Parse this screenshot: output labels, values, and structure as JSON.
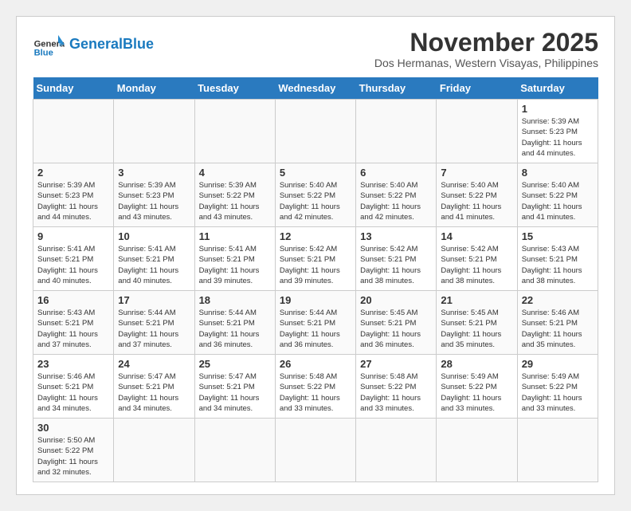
{
  "header": {
    "logo_general": "General",
    "logo_blue": "Blue",
    "month_title": "November 2025",
    "subtitle": "Dos Hermanas, Western Visayas, Philippines"
  },
  "weekdays": [
    "Sunday",
    "Monday",
    "Tuesday",
    "Wednesday",
    "Thursday",
    "Friday",
    "Saturday"
  ],
  "weeks": [
    [
      {
        "day": "",
        "sunrise": "",
        "sunset": "",
        "daylight": ""
      },
      {
        "day": "",
        "sunrise": "",
        "sunset": "",
        "daylight": ""
      },
      {
        "day": "",
        "sunrise": "",
        "sunset": "",
        "daylight": ""
      },
      {
        "day": "",
        "sunrise": "",
        "sunset": "",
        "daylight": ""
      },
      {
        "day": "",
        "sunrise": "",
        "sunset": "",
        "daylight": ""
      },
      {
        "day": "",
        "sunrise": "",
        "sunset": "",
        "daylight": ""
      },
      {
        "day": "1",
        "sunrise": "Sunrise: 5:39 AM",
        "sunset": "Sunset: 5:23 PM",
        "daylight": "Daylight: 11 hours and 44 minutes."
      }
    ],
    [
      {
        "day": "2",
        "sunrise": "Sunrise: 5:39 AM",
        "sunset": "Sunset: 5:23 PM",
        "daylight": "Daylight: 11 hours and 44 minutes."
      },
      {
        "day": "3",
        "sunrise": "Sunrise: 5:39 AM",
        "sunset": "Sunset: 5:23 PM",
        "daylight": "Daylight: 11 hours and 43 minutes."
      },
      {
        "day": "4",
        "sunrise": "Sunrise: 5:39 AM",
        "sunset": "Sunset: 5:22 PM",
        "daylight": "Daylight: 11 hours and 43 minutes."
      },
      {
        "day": "5",
        "sunrise": "Sunrise: 5:40 AM",
        "sunset": "Sunset: 5:22 PM",
        "daylight": "Daylight: 11 hours and 42 minutes."
      },
      {
        "day": "6",
        "sunrise": "Sunrise: 5:40 AM",
        "sunset": "Sunset: 5:22 PM",
        "daylight": "Daylight: 11 hours and 42 minutes."
      },
      {
        "day": "7",
        "sunrise": "Sunrise: 5:40 AM",
        "sunset": "Sunset: 5:22 PM",
        "daylight": "Daylight: 11 hours and 41 minutes."
      },
      {
        "day": "8",
        "sunrise": "Sunrise: 5:40 AM",
        "sunset": "Sunset: 5:22 PM",
        "daylight": "Daylight: 11 hours and 41 minutes."
      }
    ],
    [
      {
        "day": "9",
        "sunrise": "Sunrise: 5:41 AM",
        "sunset": "Sunset: 5:21 PM",
        "daylight": "Daylight: 11 hours and 40 minutes."
      },
      {
        "day": "10",
        "sunrise": "Sunrise: 5:41 AM",
        "sunset": "Sunset: 5:21 PM",
        "daylight": "Daylight: 11 hours and 40 minutes."
      },
      {
        "day": "11",
        "sunrise": "Sunrise: 5:41 AM",
        "sunset": "Sunset: 5:21 PM",
        "daylight": "Daylight: 11 hours and 39 minutes."
      },
      {
        "day": "12",
        "sunrise": "Sunrise: 5:42 AM",
        "sunset": "Sunset: 5:21 PM",
        "daylight": "Daylight: 11 hours and 39 minutes."
      },
      {
        "day": "13",
        "sunrise": "Sunrise: 5:42 AM",
        "sunset": "Sunset: 5:21 PM",
        "daylight": "Daylight: 11 hours and 38 minutes."
      },
      {
        "day": "14",
        "sunrise": "Sunrise: 5:42 AM",
        "sunset": "Sunset: 5:21 PM",
        "daylight": "Daylight: 11 hours and 38 minutes."
      },
      {
        "day": "15",
        "sunrise": "Sunrise: 5:43 AM",
        "sunset": "Sunset: 5:21 PM",
        "daylight": "Daylight: 11 hours and 38 minutes."
      }
    ],
    [
      {
        "day": "16",
        "sunrise": "Sunrise: 5:43 AM",
        "sunset": "Sunset: 5:21 PM",
        "daylight": "Daylight: 11 hours and 37 minutes."
      },
      {
        "day": "17",
        "sunrise": "Sunrise: 5:44 AM",
        "sunset": "Sunset: 5:21 PM",
        "daylight": "Daylight: 11 hours and 37 minutes."
      },
      {
        "day": "18",
        "sunrise": "Sunrise: 5:44 AM",
        "sunset": "Sunset: 5:21 PM",
        "daylight": "Daylight: 11 hours and 36 minutes."
      },
      {
        "day": "19",
        "sunrise": "Sunrise: 5:44 AM",
        "sunset": "Sunset: 5:21 PM",
        "daylight": "Daylight: 11 hours and 36 minutes."
      },
      {
        "day": "20",
        "sunrise": "Sunrise: 5:45 AM",
        "sunset": "Sunset: 5:21 PM",
        "daylight": "Daylight: 11 hours and 36 minutes."
      },
      {
        "day": "21",
        "sunrise": "Sunrise: 5:45 AM",
        "sunset": "Sunset: 5:21 PM",
        "daylight": "Daylight: 11 hours and 35 minutes."
      },
      {
        "day": "22",
        "sunrise": "Sunrise: 5:46 AM",
        "sunset": "Sunset: 5:21 PM",
        "daylight": "Daylight: 11 hours and 35 minutes."
      }
    ],
    [
      {
        "day": "23",
        "sunrise": "Sunrise: 5:46 AM",
        "sunset": "Sunset: 5:21 PM",
        "daylight": "Daylight: 11 hours and 34 minutes."
      },
      {
        "day": "24",
        "sunrise": "Sunrise: 5:47 AM",
        "sunset": "Sunset: 5:21 PM",
        "daylight": "Daylight: 11 hours and 34 minutes."
      },
      {
        "day": "25",
        "sunrise": "Sunrise: 5:47 AM",
        "sunset": "Sunset: 5:21 PM",
        "daylight": "Daylight: 11 hours and 34 minutes."
      },
      {
        "day": "26",
        "sunrise": "Sunrise: 5:48 AM",
        "sunset": "Sunset: 5:22 PM",
        "daylight": "Daylight: 11 hours and 33 minutes."
      },
      {
        "day": "27",
        "sunrise": "Sunrise: 5:48 AM",
        "sunset": "Sunset: 5:22 PM",
        "daylight": "Daylight: 11 hours and 33 minutes."
      },
      {
        "day": "28",
        "sunrise": "Sunrise: 5:49 AM",
        "sunset": "Sunset: 5:22 PM",
        "daylight": "Daylight: 11 hours and 33 minutes."
      },
      {
        "day": "29",
        "sunrise": "Sunrise: 5:49 AM",
        "sunset": "Sunset: 5:22 PM",
        "daylight": "Daylight: 11 hours and 33 minutes."
      }
    ],
    [
      {
        "day": "30",
        "sunrise": "Sunrise: 5:50 AM",
        "sunset": "Sunset: 5:22 PM",
        "daylight": "Daylight: 11 hours and 32 minutes."
      },
      {
        "day": "",
        "sunrise": "",
        "sunset": "",
        "daylight": ""
      },
      {
        "day": "",
        "sunrise": "",
        "sunset": "",
        "daylight": ""
      },
      {
        "day": "",
        "sunrise": "",
        "sunset": "",
        "daylight": ""
      },
      {
        "day": "",
        "sunrise": "",
        "sunset": "",
        "daylight": ""
      },
      {
        "day": "",
        "sunrise": "",
        "sunset": "",
        "daylight": ""
      },
      {
        "day": "",
        "sunrise": "",
        "sunset": "",
        "daylight": ""
      }
    ]
  ]
}
